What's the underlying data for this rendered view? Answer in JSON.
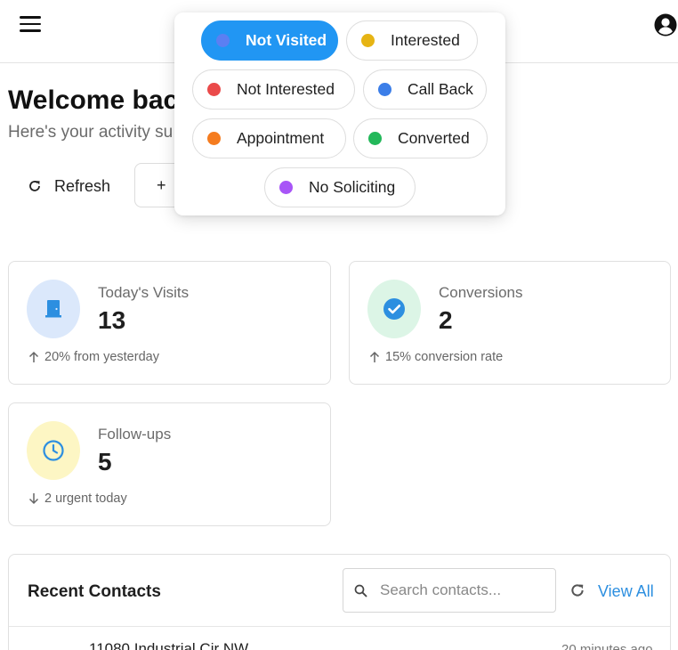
{
  "header": {
    "menu_icon": "hamburger-menu-icon",
    "account_icon": "account-circle-icon"
  },
  "welcome": {
    "title": "Welcome bac",
    "subtitle": "Here's your activity su"
  },
  "actions": {
    "refresh_label": "Refresh",
    "new_label": "+"
  },
  "stats": [
    {
      "label": "Today's Visits",
      "value": "13",
      "trend": "20% from yesterday",
      "trend_direction": "up",
      "icon": "door-icon",
      "icon_bg": "#dbe8fb",
      "icon_color": "#2d8fe0"
    },
    {
      "label": "Conversions",
      "value": "2",
      "trend": "15% conversion rate",
      "trend_direction": "up",
      "icon": "check-circle-icon",
      "icon_bg": "#dcf5e6",
      "icon_color": "#2d8fe0"
    },
    {
      "label": "Follow-ups",
      "value": "5",
      "trend": "2 urgent today",
      "trend_direction": "down",
      "icon": "clock-icon",
      "icon_bg": "#fdf6c4",
      "icon_color": "#2d8fe0"
    }
  ],
  "recent_contacts": {
    "title": "Recent Contacts",
    "search_placeholder": "Search contacts...",
    "view_all_label": "View All",
    "rows": [
      {
        "address": "11080 Industrial Cir NW",
        "time": "20 minutes ago"
      }
    ]
  },
  "status_filter": {
    "options": [
      {
        "label": "Not Visited",
        "color": "#5b7ff2",
        "selected": true
      },
      {
        "label": "Interested",
        "color": "#e6b414",
        "selected": false
      },
      {
        "label": "Not Interested",
        "color": "#ea4a4a",
        "selected": false
      },
      {
        "label": "Call Back",
        "color": "#3b7ee8",
        "selected": false
      },
      {
        "label": "Appointment",
        "color": "#f57c1f",
        "selected": false
      },
      {
        "label": "Converted",
        "color": "#23b85a",
        "selected": false
      },
      {
        "label": "No Soliciting",
        "color": "#a855f7",
        "selected": false
      }
    ]
  },
  "colors": {
    "accent": "#2196f3",
    "link": "#2d8fe0"
  }
}
